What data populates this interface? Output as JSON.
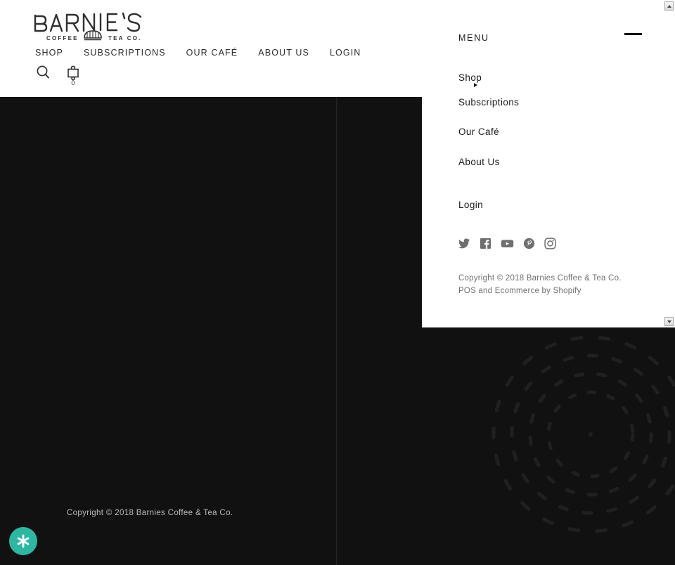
{
  "site": {
    "brand_name": "BARNIE'S",
    "brand_tagline_left": "COFFEE",
    "brand_tagline_right": "TEA CO.",
    "background_dark": "#111111",
    "accent_teal": "#2BB8A3"
  },
  "header": {
    "nav": [
      {
        "label": "SHOP"
      },
      {
        "label": "SUBSCRIPTIONS"
      },
      {
        "label": "OUR CAFÉ"
      },
      {
        "label": "ABOUT US"
      },
      {
        "label": "LOGIN"
      }
    ],
    "search_icon": "search-icon",
    "cart_icon": "cart-icon",
    "cart_count": "0"
  },
  "menu_panel": {
    "title": "MENU",
    "close_icon": "minus-icon",
    "links": [
      {
        "label": "Shop",
        "has_submenu": true,
        "submenu_icon": "caret-right-icon"
      },
      {
        "label": "Subscriptions",
        "has_submenu": false
      },
      {
        "label": "Our Café",
        "has_submenu": false
      },
      {
        "label": "About Us",
        "has_submenu": false
      },
      {
        "label": "Login",
        "has_submenu": false
      }
    ],
    "social": [
      {
        "name": "twitter-icon",
        "label": "Twitter"
      },
      {
        "name": "facebook-icon",
        "label": "Facebook"
      },
      {
        "name": "youtube-icon",
        "label": "YouTube"
      },
      {
        "name": "pinterest-icon",
        "label": "Pinterest"
      },
      {
        "name": "instagram-icon",
        "label": "Instagram"
      }
    ],
    "copyright": "Copyright © 2018 Barnies Coffee & Tea Co.",
    "pos_line_prefix": "POS",
    "pos_line_middle": " and ",
    "pos_line_link": "Ecommerce by Shopify"
  },
  "page_footer": {
    "copyright": "Copyright © 2018 Barnies Coffee & Tea Co."
  },
  "fab": {
    "icon": "asterisk-icon",
    "color": "#2BB8A3"
  },
  "scrollbar": {
    "up_icon": "scroll-up-arrow-icon",
    "down_icon": "scroll-down-arrow-icon"
  }
}
